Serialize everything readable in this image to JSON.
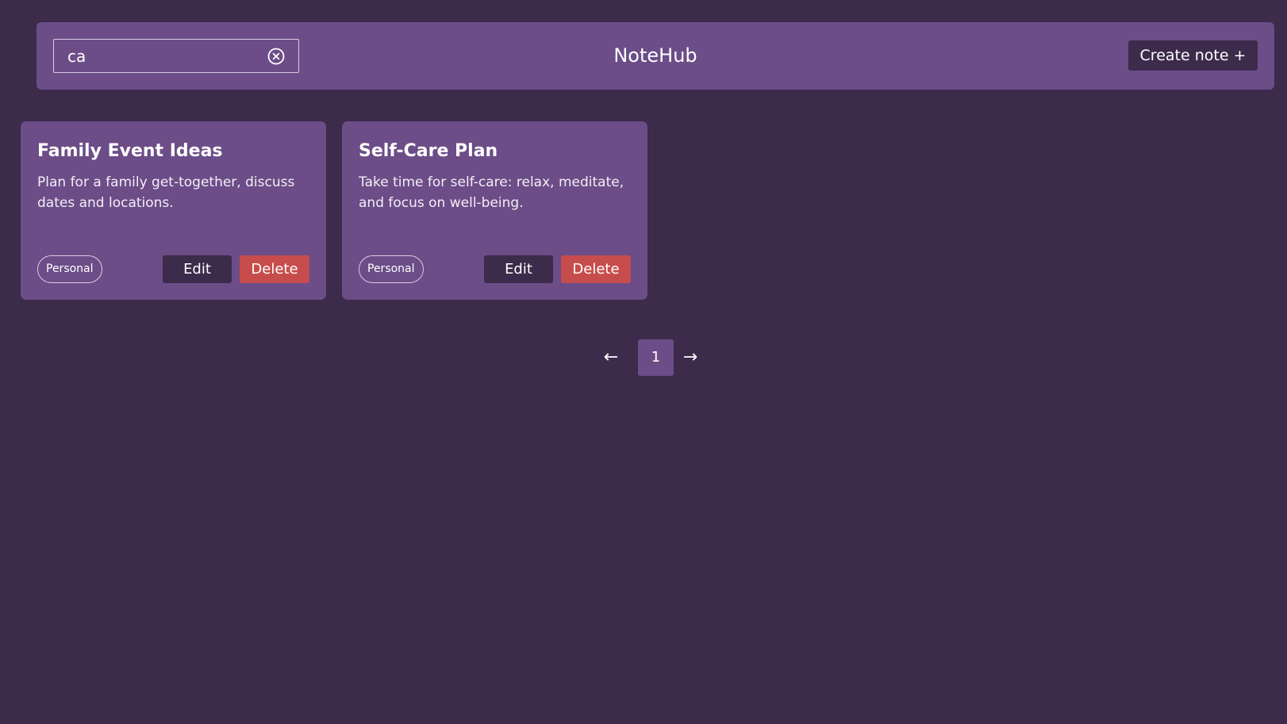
{
  "header": {
    "app_title": "NoteHub",
    "create_label": "Create note +",
    "search": {
      "value": "ca",
      "clear_icon": "close-circle-icon"
    }
  },
  "notes": [
    {
      "title": "Family Event Ideas",
      "content": "Plan for a family get-together, discuss dates and locations.",
      "tag": "Personal",
      "edit_label": "Edit",
      "delete_label": "Delete"
    },
    {
      "title": "Self-Care Plan",
      "content": "Take time for self-care: relax, meditate, and focus on well-being.",
      "tag": "Personal",
      "edit_label": "Edit",
      "delete_label": "Delete"
    }
  ],
  "pagination": {
    "prev": "←",
    "current_page": "1",
    "next": "→"
  },
  "colors": {
    "background": "#3c2b4b",
    "panel": "#6c4d87",
    "delete": "#c74d4d"
  }
}
